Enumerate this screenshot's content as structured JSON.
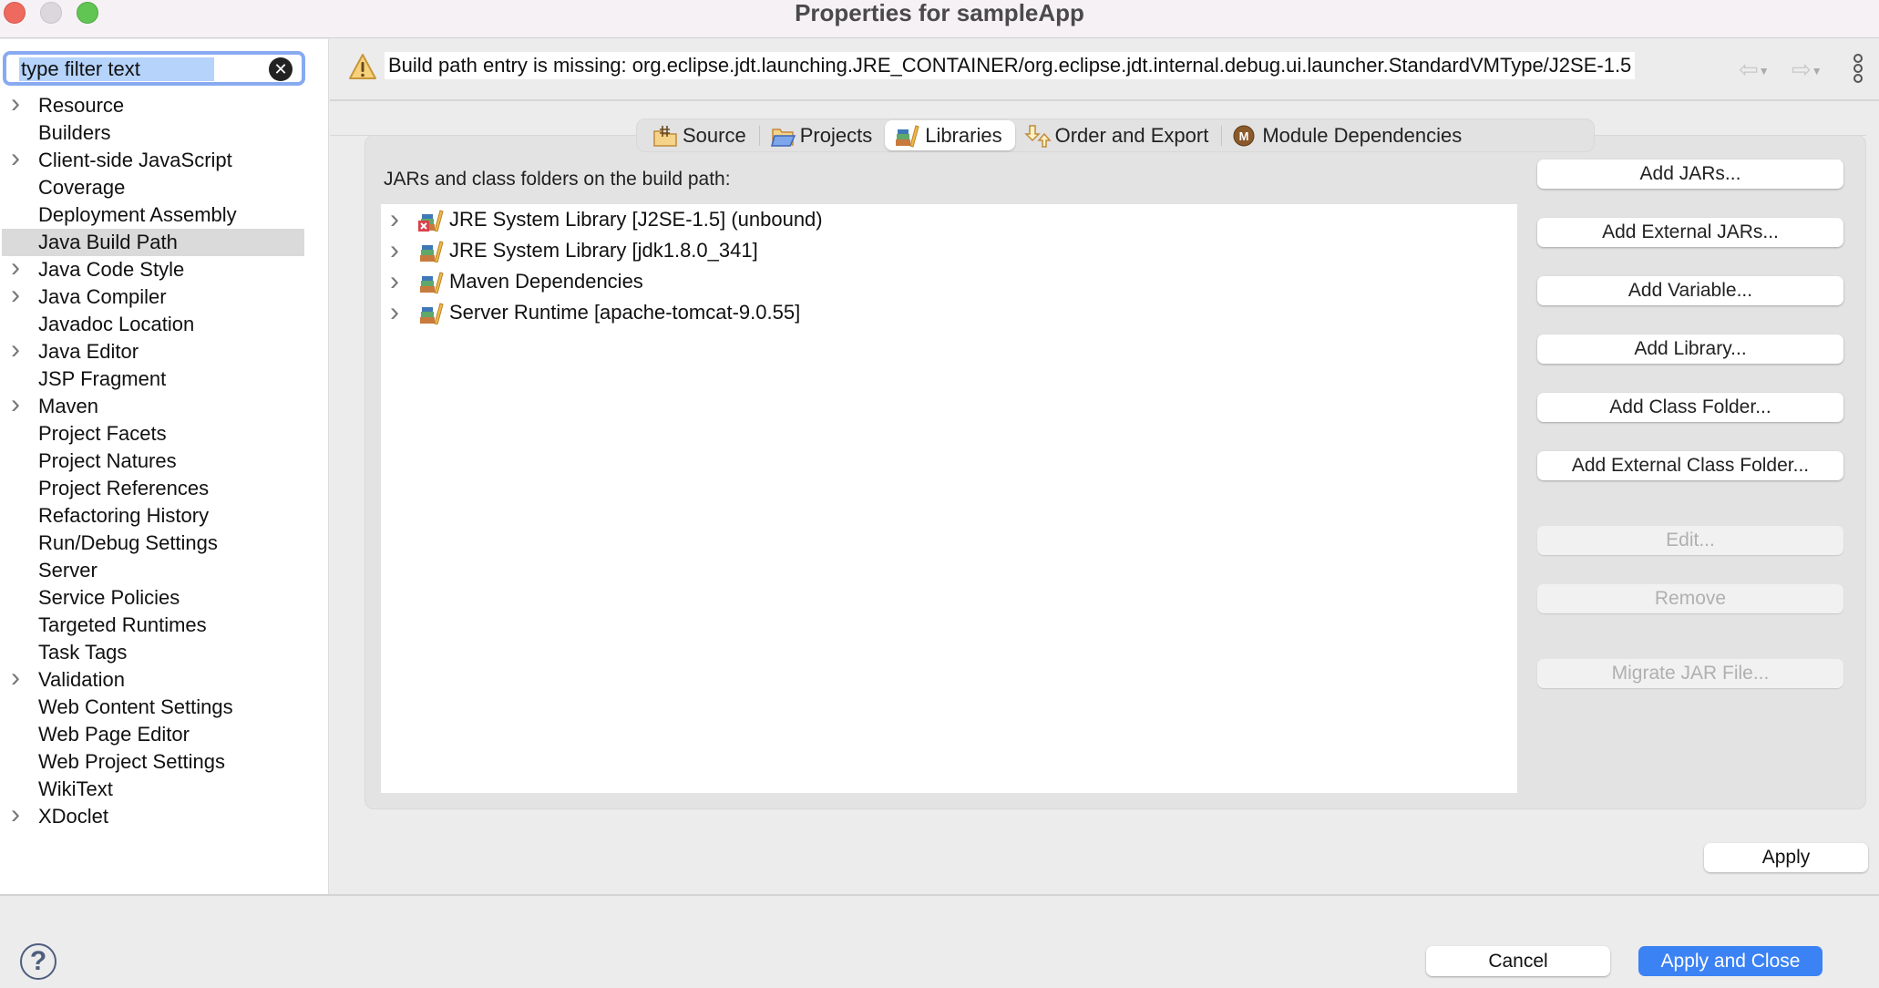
{
  "window": {
    "title": "Properties for sampleApp"
  },
  "sidebar": {
    "filter": {
      "value": "type filter text",
      "placeholder": "type filter text"
    },
    "items": [
      {
        "label": "Resource",
        "expandable": true
      },
      {
        "label": "Builders",
        "expandable": false
      },
      {
        "label": "Client-side JavaScript",
        "expandable": true
      },
      {
        "label": "Coverage",
        "expandable": false
      },
      {
        "label": "Deployment Assembly",
        "expandable": false
      },
      {
        "label": "Java Build Path",
        "expandable": false,
        "selected": true
      },
      {
        "label": "Java Code Style",
        "expandable": true
      },
      {
        "label": "Java Compiler",
        "expandable": true
      },
      {
        "label": "Javadoc Location",
        "expandable": false
      },
      {
        "label": "Java Editor",
        "expandable": true
      },
      {
        "label": "JSP Fragment",
        "expandable": false
      },
      {
        "label": "Maven",
        "expandable": true
      },
      {
        "label": "Project Facets",
        "expandable": false
      },
      {
        "label": "Project Natures",
        "expandable": false
      },
      {
        "label": "Project References",
        "expandable": false
      },
      {
        "label": "Refactoring History",
        "expandable": false
      },
      {
        "label": "Run/Debug Settings",
        "expandable": false
      },
      {
        "label": "Server",
        "expandable": false
      },
      {
        "label": "Service Policies",
        "expandable": false
      },
      {
        "label": "Targeted Runtimes",
        "expandable": false
      },
      {
        "label": "Task Tags",
        "expandable": false
      },
      {
        "label": "Validation",
        "expandable": true
      },
      {
        "label": "Web Content Settings",
        "expandable": false
      },
      {
        "label": "Web Page Editor",
        "expandable": false
      },
      {
        "label": "Web Project Settings",
        "expandable": false
      },
      {
        "label": "WikiText",
        "expandable": false
      },
      {
        "label": "XDoclet",
        "expandable": true
      }
    ]
  },
  "banner": {
    "icon": "warning-icon",
    "message": "Build path entry is missing: org.eclipse.jdt.launching.JRE_CONTAINER/org.eclipse.jdt.internal.debug.ui.launcher.StandardVMType/J2SE-1.5"
  },
  "tabs": [
    {
      "label": "Source",
      "icon": "source-folder-icon"
    },
    {
      "label": "Projects",
      "icon": "projects-icon"
    },
    {
      "label": "Libraries",
      "icon": "libraries-icon",
      "active": true
    },
    {
      "label": "Order and Export",
      "icon": "order-export-icon"
    },
    {
      "label": "Module Dependencies",
      "icon": "module-icon"
    }
  ],
  "libraries": {
    "label": "JARs and class folders on the build path:",
    "entries": [
      {
        "label": "JRE System Library [J2SE-1.5] (unbound)",
        "error": true
      },
      {
        "label": "JRE System Library [jdk1.8.0_341]",
        "error": false
      },
      {
        "label": "Maven Dependencies",
        "error": false
      },
      {
        "label": "Server Runtime [apache-tomcat-9.0.55]",
        "error": false
      }
    ],
    "buttons": [
      {
        "label": "Add JARs...",
        "enabled": true
      },
      {
        "label": "Add External JARs...",
        "enabled": true
      },
      {
        "label": "Add Variable...",
        "enabled": true
      },
      {
        "label": "Add Library...",
        "enabled": true
      },
      {
        "label": "Add Class Folder...",
        "enabled": true
      },
      {
        "label": "Add External Class Folder...",
        "enabled": true
      },
      {
        "label": "Edit...",
        "enabled": false
      },
      {
        "label": "Remove",
        "enabled": false
      },
      {
        "label": "Migrate JAR File...",
        "enabled": false
      }
    ]
  },
  "actions": {
    "apply": "Apply",
    "cancel": "Cancel",
    "apply_and_close": "Apply and Close",
    "help": "?"
  },
  "colors": {
    "accent": "#3b82f4",
    "selection": "#dadada",
    "filter_focus": "#88aaf0"
  }
}
